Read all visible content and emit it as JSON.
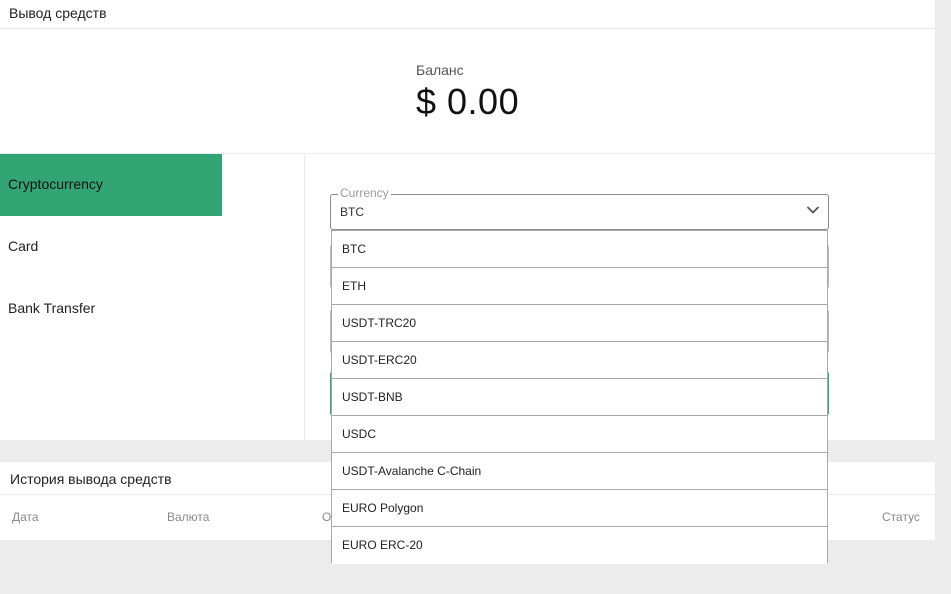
{
  "withdraw": {
    "title": "Вывод средств",
    "balance_label": "Баланс",
    "balance_value": "$ 0.00"
  },
  "methods": [
    {
      "label": "Cryptocurrency",
      "active": true
    },
    {
      "label": "Card",
      "active": false
    },
    {
      "label": "Bank Transfer",
      "active": false
    }
  ],
  "currency": {
    "legend": "Currency",
    "selected": "BTC",
    "chevron_icon": "chevron-down-icon",
    "options": [
      "BTC",
      "ETH",
      "USDT-TRC20",
      "USDT-ERC20",
      "USDT-BNB",
      "USDC",
      "USDT-Avalanche C-Chain",
      "EURO Polygon",
      "EURO ERC-20"
    ]
  },
  "history": {
    "title": "История вывода средств",
    "columns": [
      "Дата",
      "Валюта",
      "О",
      "Статус"
    ]
  },
  "colors": {
    "accent": "#33a474",
    "background": "#ececec"
  }
}
